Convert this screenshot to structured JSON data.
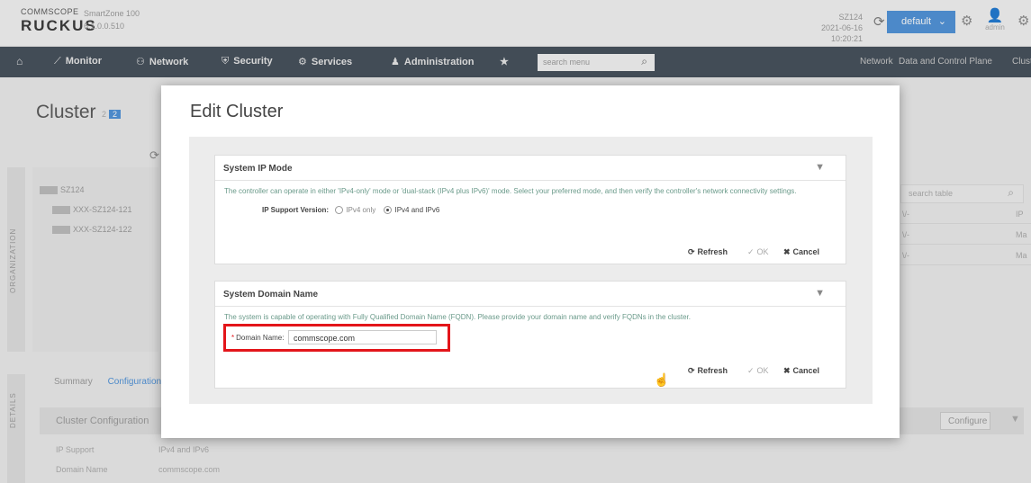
{
  "header": {
    "brand_top": "COMMSCOPE",
    "brand_main": "RUCKUS",
    "product": "SmartZone 100",
    "version": "6.1.0.0.510",
    "system_name": "SZ124",
    "system_time": "2021-06-16 10:20:21",
    "domain_select": "default",
    "user": "admin"
  },
  "nav": {
    "monitor": "Monitor",
    "network": "Network",
    "security": "Security",
    "services": "Services",
    "administration": "Administration",
    "search_placeholder": "search menu",
    "right_network": "Network",
    "right_dcp": "Data and Control Plane",
    "right_cluster": "Clust"
  },
  "page": {
    "title": "Cluster",
    "count_a": "2",
    "count_b": "2",
    "org_label": "ORGANIZATION",
    "details_label": "DETAILS",
    "tree": [
      "SZ124",
      "XXX-SZ124-121",
      "XXX-SZ124-122"
    ],
    "tabs": [
      "Summary",
      "Configuration"
    ],
    "cluster_config_title": "Cluster Configuration",
    "configure_label": "Configure",
    "ip_support_key": "IP Support",
    "ip_support_val": "IPv4 and IPv6",
    "domain_key": "Domain Name",
    "domain_val": "commscope.com",
    "search_table": "search table",
    "grid_rows": [
      {
        "a": "\\/-",
        "b": "IP"
      },
      {
        "a": "\\/-",
        "b": "Ma"
      },
      {
        "a": "\\/-",
        "b": "Ma"
      }
    ]
  },
  "modal": {
    "title": "Edit Cluster",
    "ip_mode": {
      "title": "System IP Mode",
      "description": "The controller can operate in either 'IPv4-only' mode or 'dual-stack (IPv4 plus IPv6)' mode. Select your preferred mode, and then verify the controller's network connectivity settings.",
      "support_label": "IP Support Version:",
      "option_ipv4": "IPv4 only",
      "option_dual": "IPv4 and IPv6",
      "selected": "IPv4 and IPv6"
    },
    "domain": {
      "title": "System Domain Name",
      "description": "The system is capable of operating with Fully Qualified Domain Name (FQDN). Please provide your domain name and verify FQDNs in the cluster.",
      "label": "Domain Name:",
      "value": "commscope.com"
    },
    "buttons": {
      "refresh": "Refresh",
      "ok": "OK",
      "cancel": "Cancel"
    }
  },
  "colors": {
    "accent": "#4a90d9",
    "highlight": "#e3151a",
    "nav_bg": "#3f4a56"
  }
}
